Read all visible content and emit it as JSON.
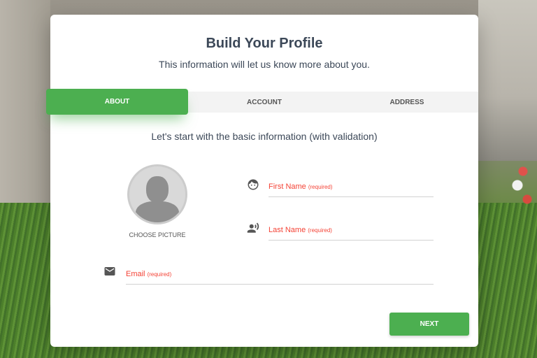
{
  "header": {
    "title": "Build Your Profile",
    "subtitle": "This information will let us know more about you."
  },
  "tabs": [
    {
      "label": "ABOUT",
      "active": true
    },
    {
      "label": "ACCOUNT",
      "active": false
    },
    {
      "label": "ADDRESS",
      "active": false
    }
  ],
  "section": {
    "title": "Let's start with the basic information (with validation)"
  },
  "avatar": {
    "label": "CHOOSE PICTURE"
  },
  "fields": {
    "first_name": {
      "label": "First Name",
      "required": "(required)",
      "icon": "face-icon",
      "value": ""
    },
    "last_name": {
      "label": "Last Name",
      "required": "(required)",
      "icon": "record-voice-icon",
      "value": ""
    },
    "email": {
      "label": "Email",
      "required": "(required)",
      "icon": "email-icon",
      "value": ""
    }
  },
  "buttons": {
    "next": "NEXT"
  },
  "colors": {
    "accent": "#4caf50",
    "error": "#f44336",
    "text": "#3c4858"
  }
}
